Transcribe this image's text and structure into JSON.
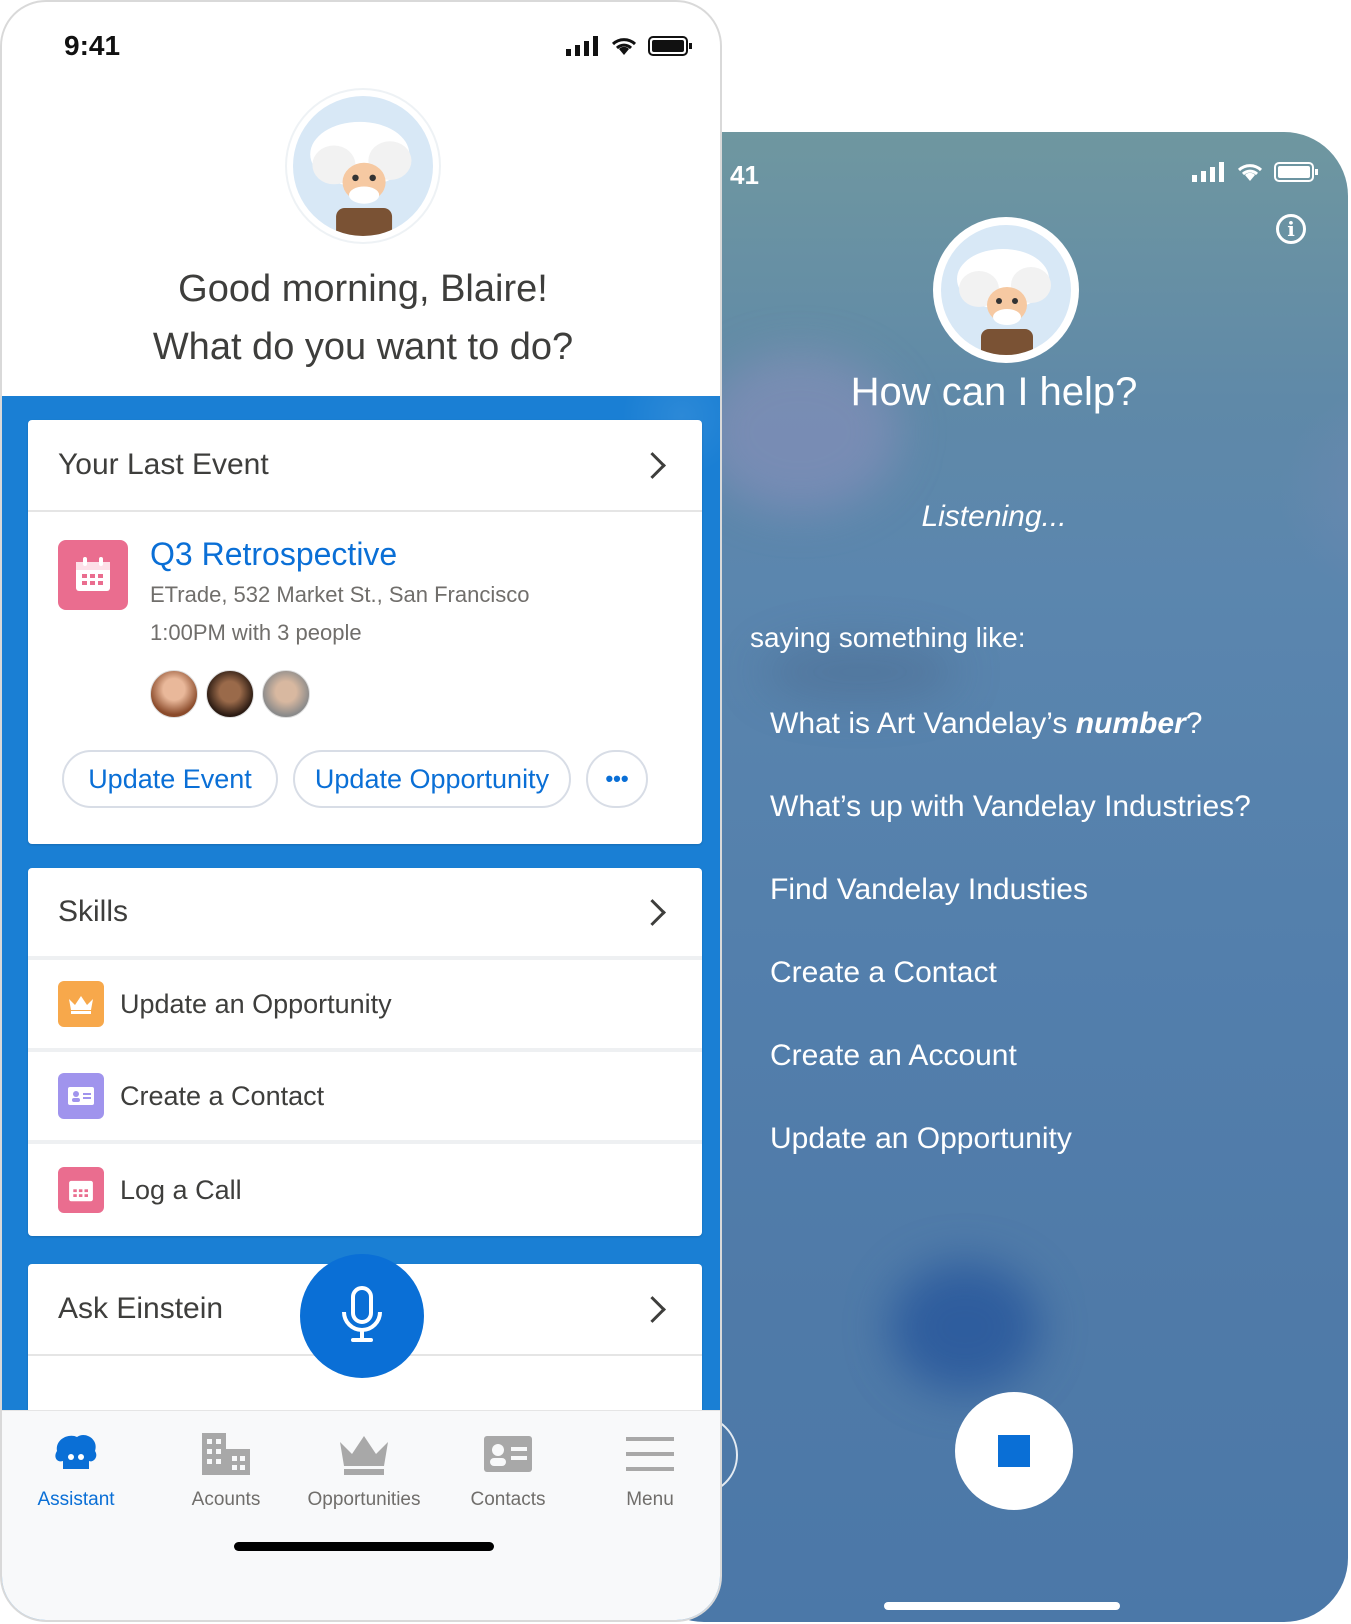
{
  "right_screen": {
    "status_time": "41",
    "title": "How can I help?",
    "listening": "Listening...",
    "hint": "saying something like:",
    "suggestions": {
      "s1_prefix": "What is Art Vandelay’s ",
      "s1_bold": "number",
      "s1_suffix": "?",
      "s2": "What’s up with Vandelay Industries?",
      "s3": "Find Vandelay Industies",
      "s4": "Create a Contact",
      "s5": "Create an Account",
      "s6": "Update an Opportunity"
    },
    "icons": {
      "info": "info-icon",
      "stop": "stop-icon",
      "speaker": "speaker-icon"
    }
  },
  "left_screen": {
    "status_time": "9:41",
    "greeting_line1": "Good morning, Blaire!",
    "greeting_line2": "What do you want to do?",
    "last_event": {
      "header": "Your Last Event",
      "title": "Q3 Retrospective",
      "address": "ETrade, 532 Market St., San Francisco",
      "time": "1:00PM with 3 people",
      "actions": {
        "update_event": "Update Event",
        "update_opportunity": "Update Opportunity",
        "more": "•••"
      }
    },
    "skills": {
      "header": "Skills",
      "items": [
        {
          "label": "Update an Opportunity",
          "color": "#f7a84b"
        },
        {
          "label": "Create a Contact",
          "color": "#a094ed"
        },
        {
          "label": "Log a Call",
          "color": "#ea6d8f"
        }
      ]
    },
    "ask": {
      "header": "Ask Einstein"
    },
    "tabs": {
      "assistant": "Assistant",
      "accounts": "Acounts",
      "opportunities": "Opportunities",
      "contacts": "Contacts",
      "menu": "Menu"
    }
  },
  "colors": {
    "brand_blue": "#0a6fd6",
    "background_blue": "#1a7fd4"
  }
}
